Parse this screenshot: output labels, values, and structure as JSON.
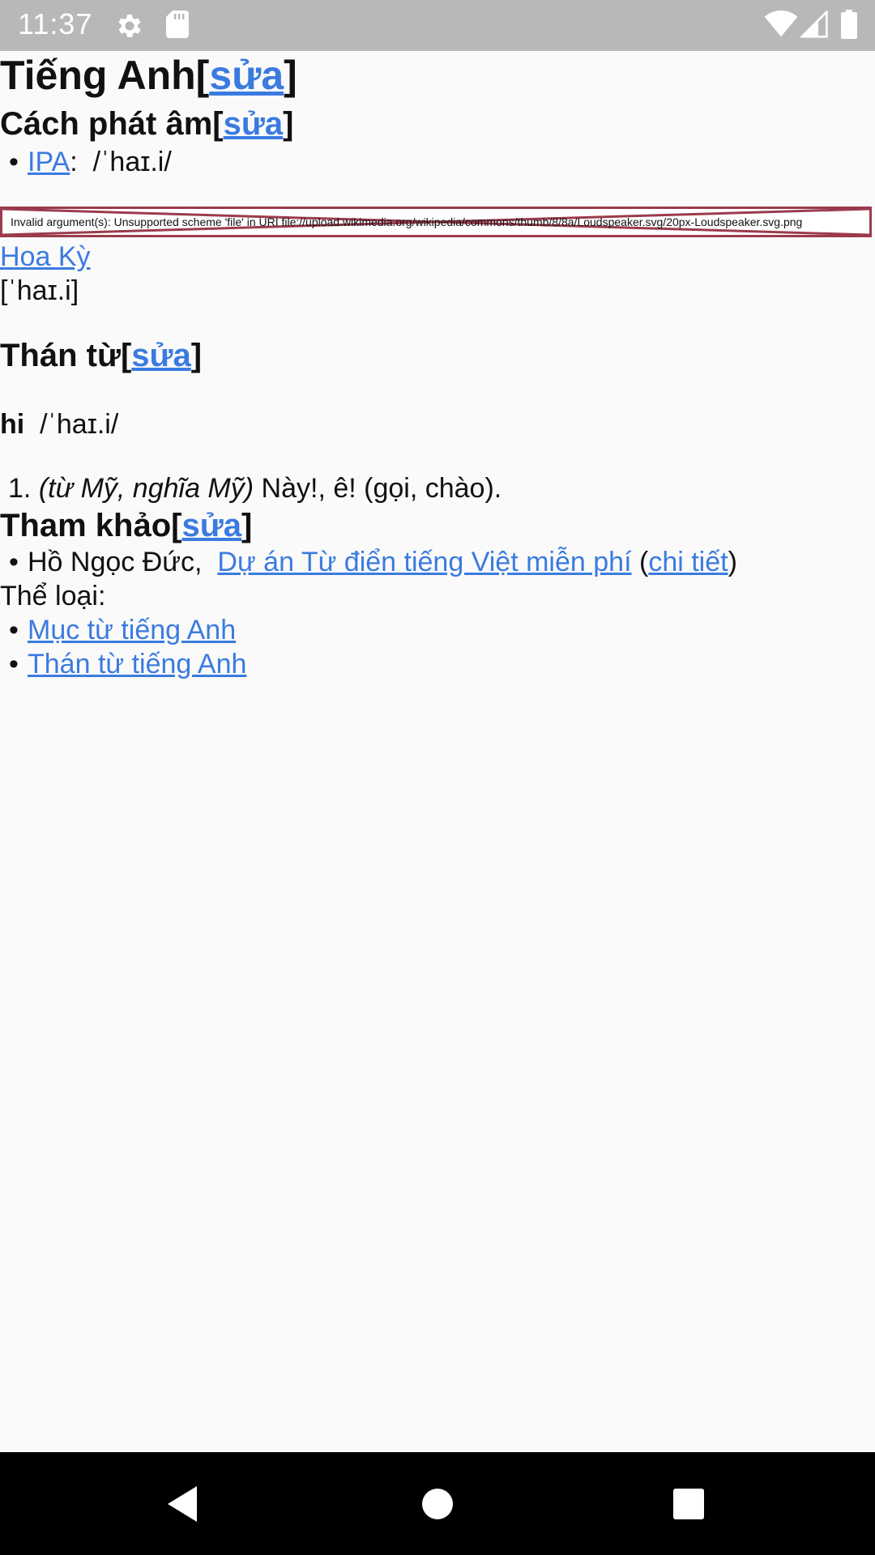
{
  "status_bar": {
    "time": "11:37"
  },
  "page": {
    "heading_lang": "Tiếng Anh",
    "edit_label": "sửa",
    "heading_pron": "Cách phát âm",
    "ipa_link": "IPA",
    "ipa_sep": ":",
    "ipa_value": "/ˈhaɪ.i/",
    "audio_error": "Invalid argument(s): Unsupported scheme 'file' in URI file://upload.wikimedia.org/wikipedia/commons/thumb/8/8a/Loudspeaker.svg/20px-Loudspeaker.svg.png",
    "region_link": "Hoa Kỳ",
    "region_ipa": "[ˈhaɪ.i]",
    "heading_pos": "Thán từ",
    "word": "hi",
    "word_ipa": "/ˈhaɪ.i/",
    "def_number": "1.",
    "def_qualifier": "(từ Mỹ, nghĩa Mỹ)",
    "def_text": "Này!, ê! (gọi, chào).",
    "heading_ref": "Tham khảo",
    "ref_author": "Hồ Ngọc Đức,",
    "ref_link": "Dự án Từ điển tiếng Việt miễn phí",
    "ref_detail_link": "chi tiết",
    "category_label": "Thể loại:",
    "categories": [
      "Mục từ tiếng Anh",
      "Thán từ tiếng Anh"
    ]
  },
  "colors": {
    "link": "#3b7be0",
    "error_border": "#9c3b4d",
    "status_bar": "#b8b8b8"
  }
}
